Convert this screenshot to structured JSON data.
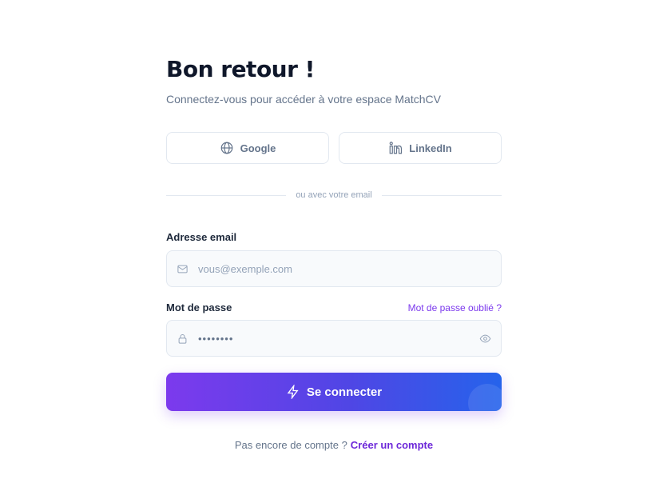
{
  "header": {
    "title": "Bon retour !",
    "subtitle": "Connectez-vous pour accéder à votre espace MatchCV"
  },
  "social": {
    "google_label": "Google",
    "linkedin_label": "LinkedIn"
  },
  "divider": {
    "text": "ou avec votre email"
  },
  "email": {
    "label": "Adresse email",
    "placeholder": "vous@exemple.com"
  },
  "password": {
    "label": "Mot de passe",
    "forgot_label": "Mot de passe oublié ?",
    "masked_value": "••••••••"
  },
  "submit": {
    "label": "Se connecter"
  },
  "signup": {
    "prompt": "Pas encore de compte ?",
    "link_label": "Créer un compte"
  },
  "icons": {
    "google": "globe-icon",
    "linkedin": "linkedin-icon",
    "email": "mail-icon",
    "password": "lock-icon",
    "toggle": "eye-icon",
    "submit": "lightning-icon"
  },
  "colors": {
    "accent": "#7c3aed",
    "gradient_end": "#2563eb",
    "link": "#6d28d9"
  }
}
